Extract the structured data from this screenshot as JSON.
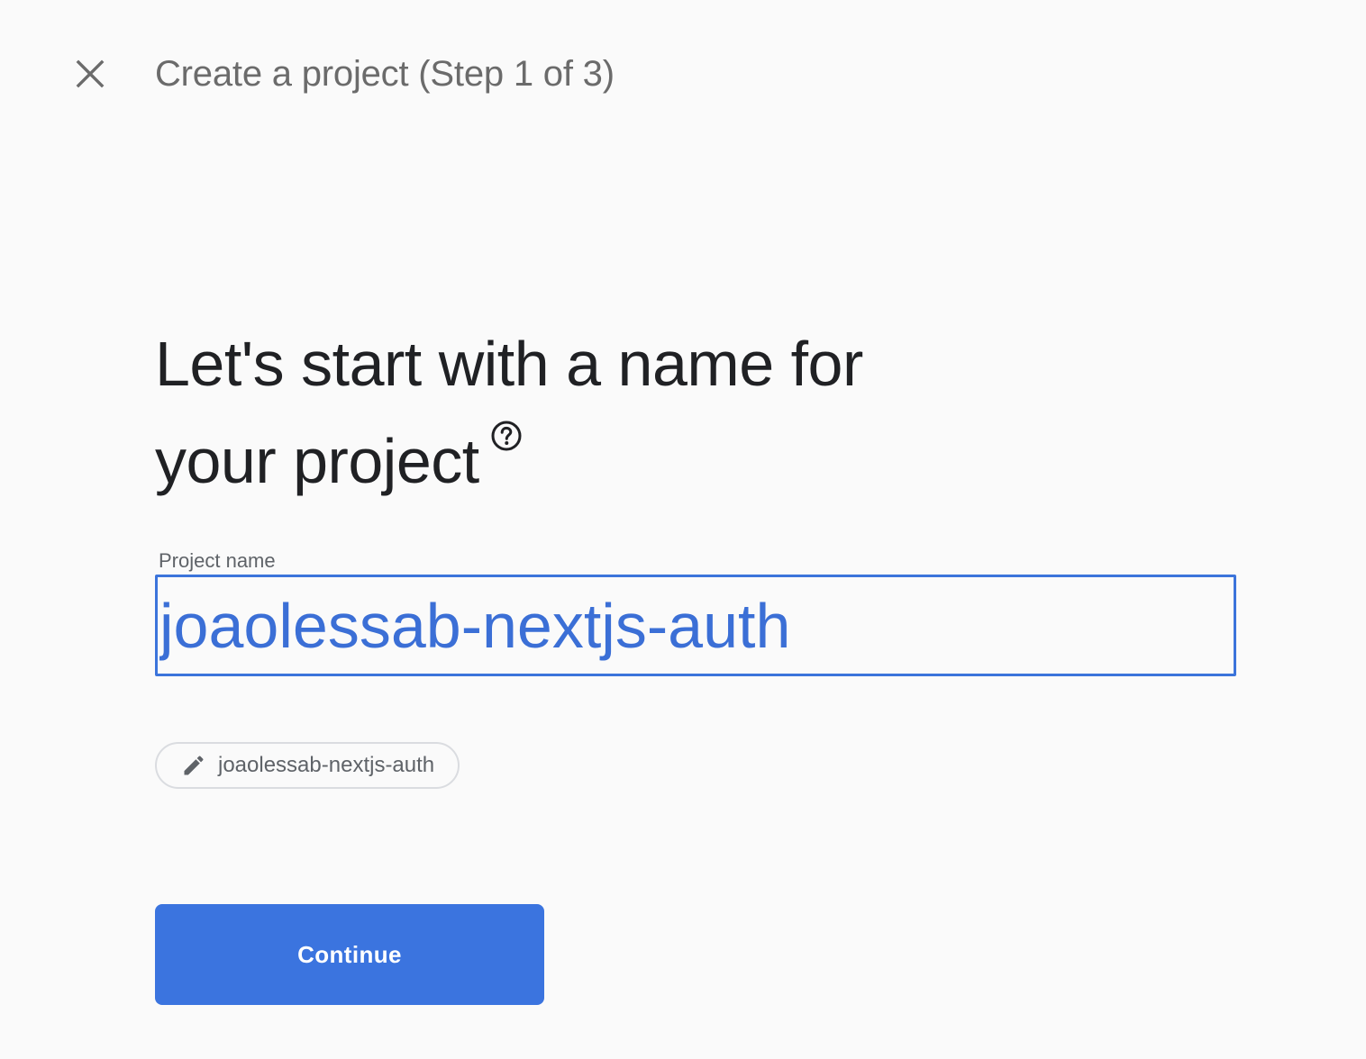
{
  "header": {
    "title": "Create a project (Step 1 of 3)",
    "close_icon": "close-icon"
  },
  "main": {
    "heading_line1": "Let's start with a name for",
    "heading_line2": "your project",
    "help_icon": "help-circle-icon",
    "project_name_label": "Project name",
    "project_name_value": "joaolessab-nextjs-auth",
    "project_id_chip": {
      "icon": "pencil-icon",
      "label": "joaolessab-nextjs-auth"
    },
    "continue_label": "Continue"
  },
  "colors": {
    "accent": "#3b74df",
    "background": "#fafafa",
    "heading": "#202124",
    "muted": "#5f6368"
  }
}
